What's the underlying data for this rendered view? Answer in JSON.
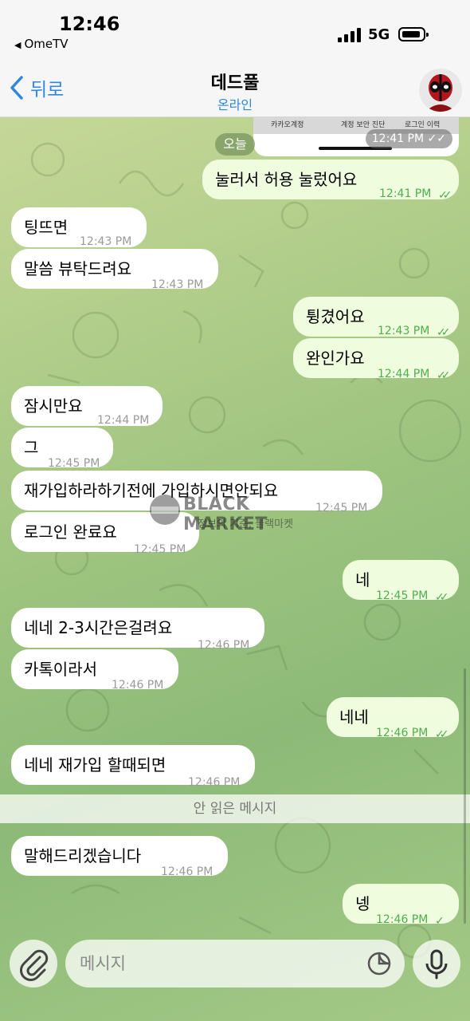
{
  "status_bar": {
    "time": "12:46",
    "back_app": "OmeTV",
    "network": "5G"
  },
  "header": {
    "back_label": "뒤로",
    "title": "데드풀",
    "subtitle": "온라인"
  },
  "preview": {
    "items": [
      "카카오계정",
      "계정 보안 진단",
      "로그인 이력"
    ],
    "time": "12:41 PM"
  },
  "date_chip": "오늘",
  "messages": [
    {
      "dir": "out",
      "text": "눌러서 허용 눌렀어요",
      "time": "12:41 PM"
    },
    {
      "dir": "in",
      "text": "팅뜨면",
      "time": "12:43 PM"
    },
    {
      "dir": "in",
      "text": "말씀 뷰탁드려요",
      "time": "12:43 PM"
    },
    {
      "dir": "out",
      "text": "튕겼어요",
      "time": "12:43 PM"
    },
    {
      "dir": "out",
      "text": "완인가요",
      "time": "12:44 PM"
    },
    {
      "dir": "in",
      "text": "잠시만요",
      "time": "12:44 PM"
    },
    {
      "dir": "in",
      "text": "그",
      "time": "12:45 PM"
    },
    {
      "dir": "in",
      "text": "재가입하라하기전에 가입하시면안되요",
      "time": "12:45 PM"
    },
    {
      "dir": "in",
      "text": "로그인 완료요",
      "time": "12:45 PM"
    },
    {
      "dir": "out",
      "text": "네",
      "time": "12:45 PM"
    },
    {
      "dir": "in",
      "text": "네네 2-3시간은걸려요",
      "time": "12:46 PM"
    },
    {
      "dir": "in",
      "text": "카톡이라서",
      "time": "12:46 PM"
    },
    {
      "dir": "out",
      "text": "네네",
      "time": "12:46 PM"
    },
    {
      "dir": "in",
      "text": "네네 재가입 할때되면",
      "time": "12:46 PM"
    },
    {
      "dir": "in",
      "text": "말해드리겠습니다",
      "time": "12:46 PM"
    },
    {
      "dir": "out",
      "text": "넹",
      "time": "12:46 PM"
    }
  ],
  "unread_label": "안 읽은 메시지",
  "watermark": {
    "title": "BLACK MARKET",
    "subtitle": "정보의 기준, 블랙마켓",
    "badge": "BLACK MARKET"
  },
  "input": {
    "placeholder": "메시지"
  },
  "colors": {
    "accent": "#2f87e0",
    "bubble_out": "#effdde",
    "bubble_in": "#ffffff",
    "check": "#4fae4e"
  }
}
